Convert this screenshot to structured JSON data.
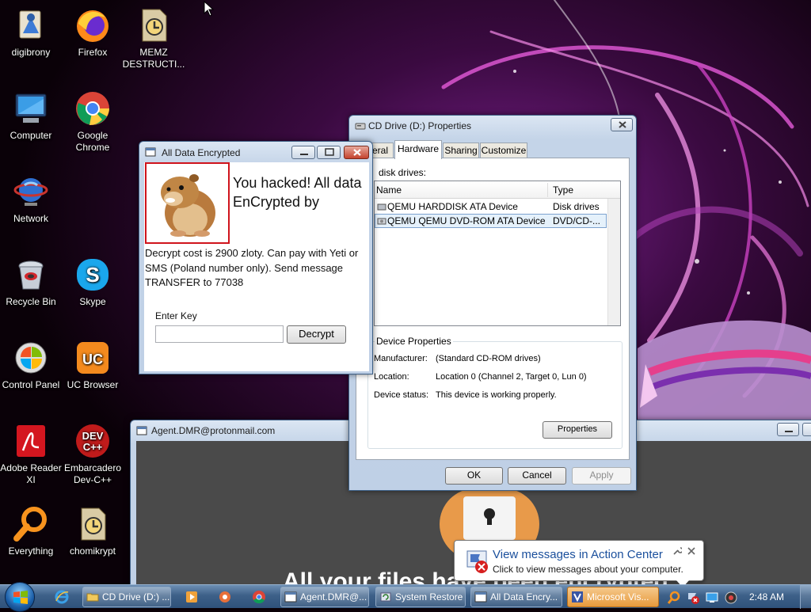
{
  "desktop": {
    "icons": [
      {
        "label": "digibrony",
        "icon": "user-folder-icon"
      },
      {
        "label": "Firefox",
        "icon": "firefox-icon"
      },
      {
        "label": "MEMZ DESTRUCTI...",
        "icon": "executable-icon"
      },
      {
        "label": "Computer",
        "icon": "computer-icon"
      },
      {
        "label": "Google Chrome",
        "icon": "chrome-icon"
      },
      {
        "label": "Network",
        "icon": "network-icon"
      },
      {
        "label": "Recycle Bin",
        "icon": "recycle-bin-icon"
      },
      {
        "label": "Skype",
        "icon": "skype-icon"
      },
      {
        "label": "Control Panel",
        "icon": "control-panel-icon"
      },
      {
        "label": "UC Browser",
        "icon": "uc-browser-icon"
      },
      {
        "label": "Adobe Reader XI",
        "icon": "adobe-reader-icon"
      },
      {
        "label": "Embarcadero Dev-C++",
        "icon": "devcpp-icon"
      },
      {
        "label": "Everything",
        "icon": "search-magnifier-icon"
      },
      {
        "label": "chomikrypt",
        "icon": "executable-icon"
      }
    ]
  },
  "ransom_window": {
    "title": "All Data Encrypted",
    "headline": "You hacked! All data EnCrypted by ChomIk",
    "message": "Decrypt cost is 2900 zloty. Can pay with Yeti or SMS (Poland number only). Send message TRANSFER to 77038",
    "key_label": "Enter Key",
    "key_value": "",
    "decrypt_label": "Decrypt"
  },
  "properties_window": {
    "title": "CD Drive (D:) Properties",
    "tabs": [
      "eral",
      "Hardware",
      "Sharing",
      "Customize"
    ],
    "active_tab": "Hardware",
    "list_caption": "disk drives:",
    "columns": [
      "Name",
      "Type"
    ],
    "devices": [
      {
        "name": "QEMU HARDDISK ATA Device",
        "type": "Disk drives"
      },
      {
        "name": "QEMU QEMU DVD-ROM ATA Device",
        "type": "DVD/CD-..."
      }
    ],
    "device_properties": {
      "legend": "Device Properties",
      "manufacturer_label": "Manufacturer:",
      "manufacturer": "(Standard CD-ROM drives)",
      "location_label": "Location:",
      "location": "Location 0 (Channel 2, Target 0, Lun 0)",
      "status_label": "Device status:",
      "status": "This device is working properly.",
      "properties_button": "Properties"
    },
    "ok": "OK",
    "cancel": "Cancel",
    "apply": "Apply"
  },
  "agent_window": {
    "title": "Agent.DMR@protonmail.com",
    "banner_text": "All your files have been encrypted"
  },
  "action_center_popup": {
    "title": "View messages in Action Center",
    "subtitle": "Click to view messages about your computer."
  },
  "taskbar": {
    "items": [
      {
        "label": "CD Drive (D:) ...",
        "icon": "folder-icon",
        "active": false
      },
      {
        "label": "Agent.DMR@...",
        "icon": "window-icon",
        "active": false
      },
      {
        "label": "System Restore",
        "icon": "system-restore-icon",
        "active": false
      },
      {
        "label": "All Data Encry...",
        "icon": "window-icon",
        "active": false
      },
      {
        "label": "Microsoft Vis...",
        "icon": "visio-icon",
        "active": true
      }
    ],
    "clock": "2:48 AM"
  },
  "colors": {
    "taskbar": "#3d6088",
    "active_task": "#e79a3c",
    "link_blue": "#1a4f9c",
    "ransom_image_border": "#d0141c"
  }
}
